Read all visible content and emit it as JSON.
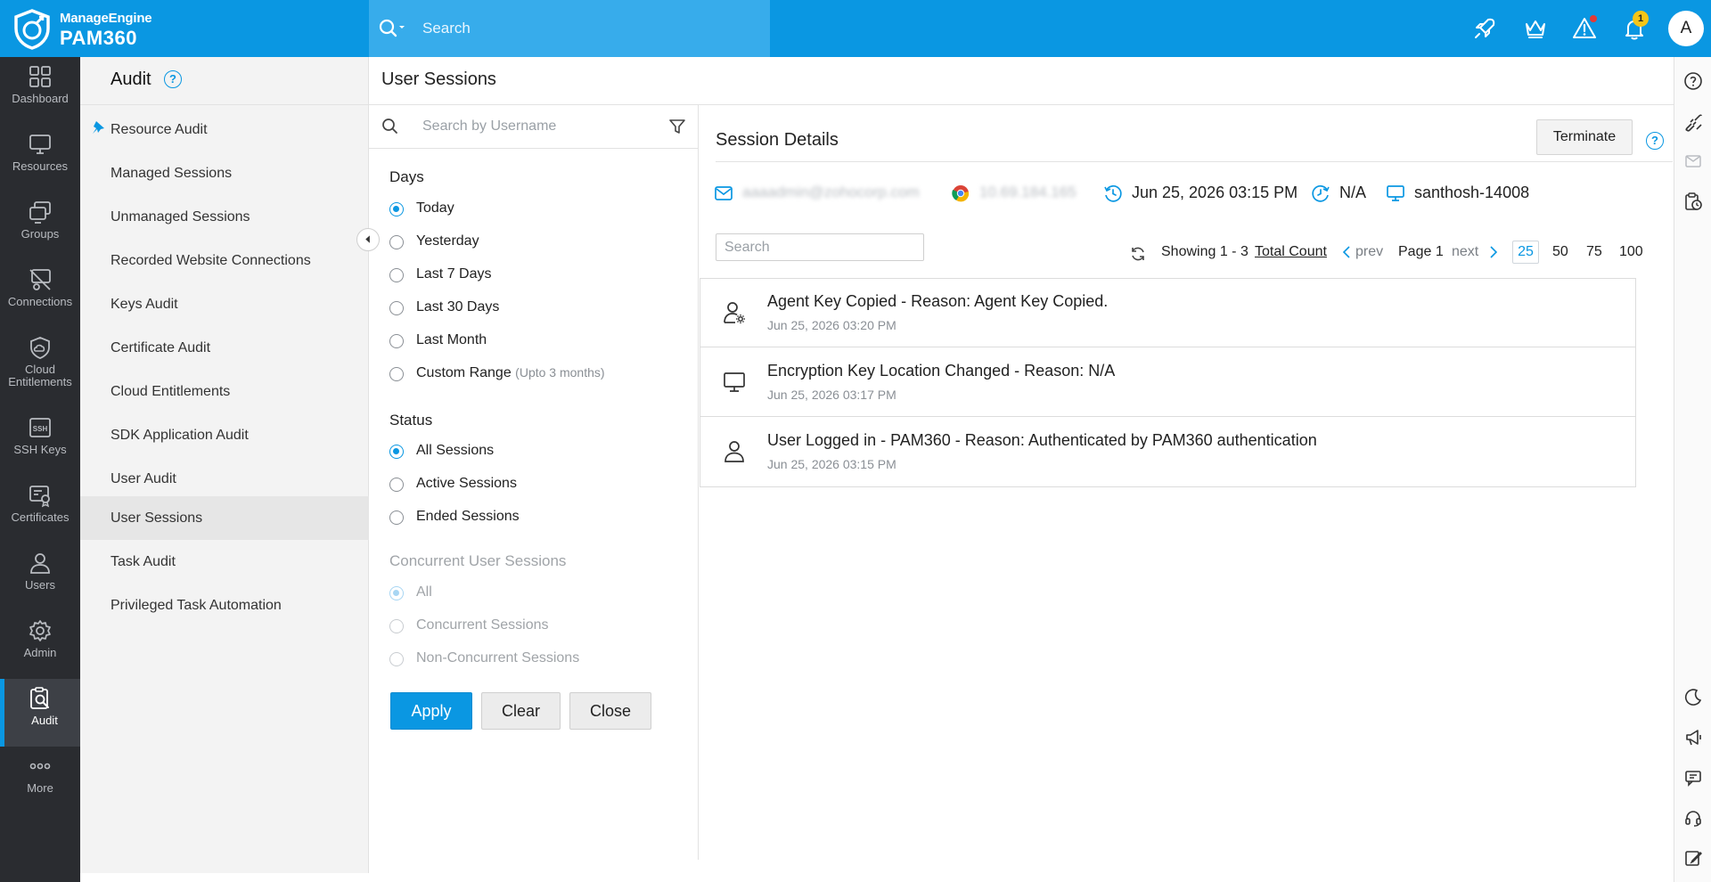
{
  "app": {
    "brand_top": "ManageEngine",
    "brand_bottom": "PAM360",
    "search_placeholder": "Search",
    "notification_count": "1",
    "avatar_initial": "A"
  },
  "nav": [
    {
      "label": "Dashboard",
      "icon": "dashboard-icon"
    },
    {
      "label": "Resources",
      "icon": "monitor-icon"
    },
    {
      "label": "Groups",
      "icon": "groups-icon"
    },
    {
      "label": "Connections",
      "icon": "connections-icon"
    },
    {
      "label": "Cloud Entitlements",
      "icon": "cloud-shield-icon"
    },
    {
      "label": "SSH Keys",
      "icon": "ssh-icon"
    },
    {
      "label": "Certificates",
      "icon": "certificate-icon"
    },
    {
      "label": "Users",
      "icon": "user-icon"
    },
    {
      "label": "Admin",
      "icon": "gear-icon"
    },
    {
      "label": "Audit",
      "icon": "audit-icon",
      "active": true
    },
    {
      "label": "More",
      "icon": "more-icon"
    }
  ],
  "submenu": {
    "title": "Audit",
    "items": [
      "Resource Audit",
      "Managed Sessions",
      "Unmanaged Sessions",
      "Recorded Website Connections",
      "Keys Audit",
      "Certificate Audit",
      "Cloud Entitlements",
      "SDK Application Audit",
      "User Audit",
      "User Sessions",
      "Task Audit",
      "Privileged Task Automation"
    ],
    "active": "User Sessions"
  },
  "page_title": "User Sessions",
  "filter": {
    "search_placeholder": "Search by Username",
    "days_heading": "Days",
    "days": [
      "Today",
      "Yesterday",
      "Last 7 Days",
      "Last 30 Days",
      "Last Month",
      "Custom Range"
    ],
    "custom_range_note": "(Upto 3 months)",
    "days_selected": "Today",
    "status_heading": "Status",
    "status": [
      "All Sessions",
      "Active Sessions",
      "Ended Sessions"
    ],
    "status_selected": "All Sessions",
    "concurrent_heading": "Concurrent User Sessions",
    "concurrent": [
      "All",
      "Concurrent Sessions",
      "Non-Concurrent Sessions"
    ],
    "concurrent_selected": "All",
    "apply": "Apply",
    "clear": "Clear",
    "close": "Close"
  },
  "details": {
    "title": "Session Details",
    "terminate": "Terminate",
    "email": "aaaadmin@zohocorp.com",
    "ip": "10.69.184.165",
    "login_time": "Jun 25, 2026 03:15 PM",
    "logout_time": "N/A",
    "host": "santhosh-14008",
    "search_placeholder": "Search",
    "showing": "Showing 1 - 3",
    "total_count": "Total Count",
    "prev": "prev",
    "page": "Page 1",
    "next": "next",
    "page_sizes": [
      "25",
      "50",
      "75",
      "100"
    ],
    "page_size_selected": "25",
    "events": [
      {
        "title": "Agent Key Copied - Reason: Agent Key Copied.",
        "time": "Jun 25, 2026 03:20 PM",
        "icon": "user-gear-icon"
      },
      {
        "title": "Encryption Key Location Changed - Reason: N/A",
        "time": "Jun 25, 2026 03:17 PM",
        "icon": "monitor-icon"
      },
      {
        "title": "User Logged in - PAM360 - Reason: Authenticated by PAM360 authentication",
        "time": "Jun 25, 2026 03:15 PM",
        "icon": "user-icon"
      }
    ]
  },
  "colors": {
    "brand_blue": "#0a97e2",
    "nav_dark": "#2a2c30",
    "badge_yellow": "#f5c518",
    "alert_red": "#e53935"
  }
}
